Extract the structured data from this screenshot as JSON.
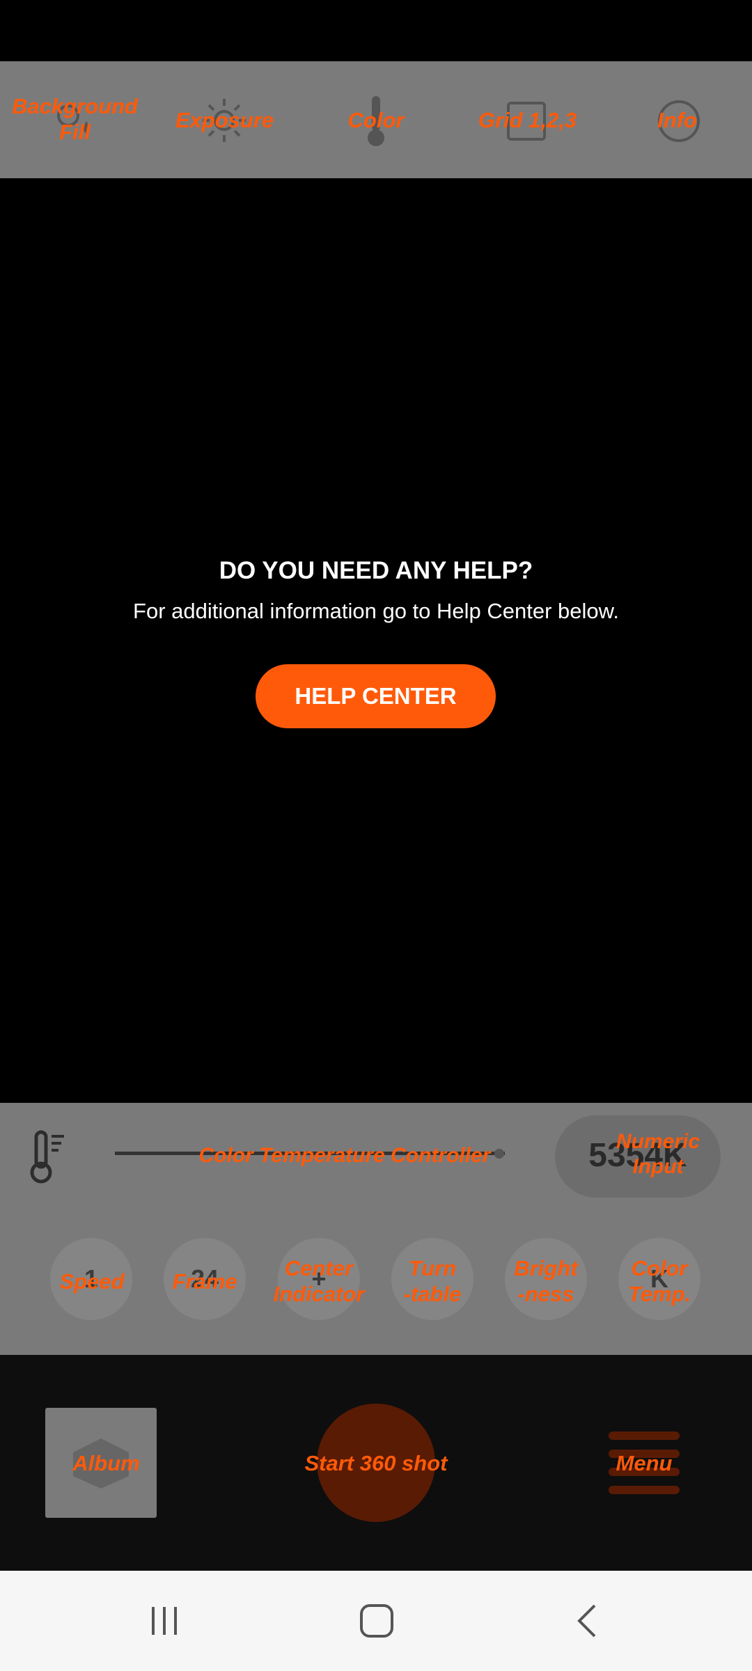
{
  "colors": {
    "accent": "#ff5a0a",
    "toolbar_bg": "#7b7b7b",
    "preview_bg": "#000000",
    "nav_bg": "#f6f6f6"
  },
  "top_toolbar": {
    "items": [
      {
        "label": "Background\nFill",
        "icon": "background-fill-icon"
      },
      {
        "label": "Exposure",
        "icon": "exposure-sun-icon"
      },
      {
        "label": "Color",
        "icon": "thermometer-icon"
      },
      {
        "label": "Grid 1,2,3",
        "icon": "grid-icon"
      },
      {
        "label": "Info",
        "icon": "info-icon"
      }
    ]
  },
  "help": {
    "title": "DO YOU NEED ANY HELP?",
    "subtitle": "For additional information go to Help Center below.",
    "button_label": "HELP CENTER"
  },
  "controls": {
    "slider_label": "Color Temperature Controller",
    "slider_icon": "thermometer-icon",
    "numeric_value": "5354K",
    "numeric_label": "Numeric\nInput",
    "buttons": [
      {
        "label": "Speed",
        "glyph": "1"
      },
      {
        "label": "Frame",
        "glyph": "24"
      },
      {
        "label": "Center\nIndicator",
        "glyph": "+"
      },
      {
        "label": "Turn\n-table",
        "glyph": ""
      },
      {
        "label": "Bright\n-ness",
        "glyph": ""
      },
      {
        "label": "Color\nTemp.",
        "glyph": "K"
      }
    ]
  },
  "bottom_bar": {
    "album_label": "Album",
    "shutter_label": "Start 360 shot",
    "menu_label": "Menu"
  },
  "nav": {
    "recents": "recents-icon",
    "home": "home-icon",
    "back": "back-icon"
  }
}
